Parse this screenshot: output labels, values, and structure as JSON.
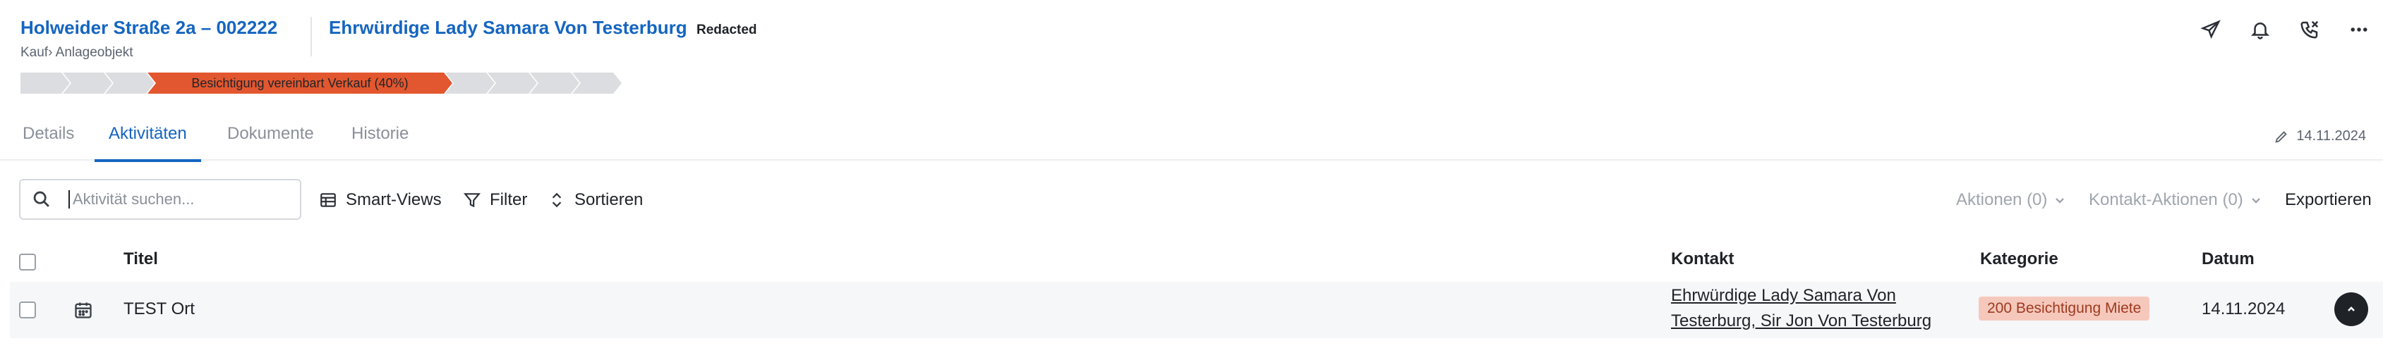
{
  "header": {
    "property_title": "Holweider Straße 2a – 002222",
    "property_subtitle": "Kauf› Anlageobjekt",
    "contact_name": "Ehrwürdige Lady Samara Von Testerburg",
    "contact_tag": "Redacted",
    "actions": [
      {
        "icon": "send-icon"
      },
      {
        "icon": "bell-icon"
      },
      {
        "icon": "phone-icon"
      },
      {
        "icon": "more-icon"
      }
    ]
  },
  "stages": {
    "active_label": "Besichtigung vereinbart Verkauf (40%)",
    "active_color": "#e2572f",
    "inactive_color": "#dcdde0"
  },
  "tabs": [
    {
      "label": "Details"
    },
    {
      "label": "Aktivitäten"
    },
    {
      "label": "Dokumente"
    },
    {
      "label": "Historie"
    }
  ],
  "active_tab": "Aktivitäten",
  "last_edited": "14.11.2024",
  "toolbar": {
    "search_placeholder": "Aktivität suchen...",
    "smart_views": "Smart-Views",
    "filter": "Filter",
    "sort": "Sortieren",
    "actions": "Aktionen (0)",
    "contact_actions": "Kontakt-Aktionen (0)",
    "export": "Exportieren"
  },
  "table": {
    "columns": {
      "title": "Titel",
      "contact": "Kontakt",
      "category": "Kategorie",
      "date": "Datum"
    },
    "rows": [
      {
        "icon": "calendar-icon",
        "title": "TEST Ort",
        "contact_line1": "Ehrwürdige Lady Samara Von",
        "contact_line2": "Testerburg, Sir Jon Von Testerburg",
        "category": "200 Besichtigung Miete",
        "date": "14.11.2024"
      }
    ]
  },
  "colors": {
    "accent": "#1565c0",
    "stage_active": "#e2572f",
    "badge_bg": "#f6c8bc"
  }
}
